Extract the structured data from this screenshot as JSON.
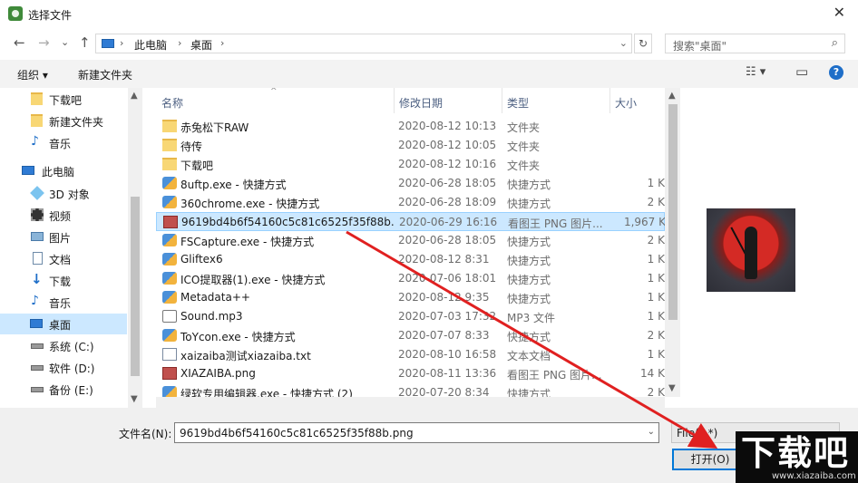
{
  "window": {
    "title": "选择文件",
    "close_glyph": "✕"
  },
  "nav_buttons": {
    "back": "←",
    "forward": "→",
    "recent": "⌄",
    "up": "↑"
  },
  "address": {
    "crumbs": [
      "此电脑",
      "桌面"
    ],
    "separator": "›",
    "dropdown": "⌄",
    "refresh": "↻"
  },
  "search": {
    "placeholder": "搜索\"桌面\"",
    "icon": "⌕"
  },
  "toolbar": {
    "organize": "组织 ▾",
    "new_folder": "新建文件夹",
    "view": "☷ ▾",
    "pane": "▭",
    "help": "?"
  },
  "sidebar": {
    "items": [
      {
        "label": "下载吧",
        "icon": "folder-icon"
      },
      {
        "label": "新建文件夹",
        "icon": "folder-icon"
      },
      {
        "label": "音乐",
        "icon": "music-icon"
      },
      {
        "label": "此电脑",
        "icon": "computer-icon"
      },
      {
        "label": "3D 对象",
        "icon": "cube-icon"
      },
      {
        "label": "视频",
        "icon": "video-icon"
      },
      {
        "label": "图片",
        "icon": "picture-icon"
      },
      {
        "label": "文档",
        "icon": "document-icon"
      },
      {
        "label": "下载",
        "icon": "download-icon"
      },
      {
        "label": "音乐",
        "icon": "music-icon"
      },
      {
        "label": "桌面",
        "icon": "desktop-icon"
      },
      {
        "label": "系统 (C:)",
        "icon": "drive-icon"
      },
      {
        "label": "软件 (D:)",
        "icon": "drive-icon"
      },
      {
        "label": "备份 (E:)",
        "icon": "drive-icon"
      }
    ],
    "selected": "桌面",
    "scroll_up": "▲",
    "scroll_down": "▼"
  },
  "columns": {
    "name": "名称",
    "date": "修改日期",
    "type": "类型",
    "size": "大小",
    "sort_arrow": "^"
  },
  "files": [
    {
      "name": "赤兔松下RAW",
      "date": "2020-08-12 10:13",
      "type": "文件夹",
      "size": "",
      "icon": "folder-icon"
    },
    {
      "name": "待传",
      "date": "2020-08-12 10:05",
      "type": "文件夹",
      "size": "",
      "icon": "folder-icon"
    },
    {
      "name": "下载吧",
      "date": "2020-08-12 10:16",
      "type": "文件夹",
      "size": "",
      "icon": "folder-icon"
    },
    {
      "name": "8uftp.exe - 快捷方式",
      "date": "2020-06-28 18:05",
      "type": "快捷方式",
      "size": "1 K",
      "icon": "shortcut-icon"
    },
    {
      "name": "360chrome.exe - 快捷方式",
      "date": "2020-06-28 18:09",
      "type": "快捷方式",
      "size": "2 K",
      "icon": "shortcut-icon"
    },
    {
      "name": "9619bd4b6f54160c5c81c6525f35f88b...",
      "date": "2020-06-29 16:16",
      "type": "看图王 PNG 图片...",
      "size": "1,967 K",
      "icon": "png-icon"
    },
    {
      "name": "FSCapture.exe - 快捷方式",
      "date": "2020-06-28 18:05",
      "type": "快捷方式",
      "size": "2 K",
      "icon": "shortcut-icon"
    },
    {
      "name": "Gliftex6",
      "date": "2020-08-12 8:31",
      "type": "快捷方式",
      "size": "1 K",
      "icon": "shortcut-icon"
    },
    {
      "name": "ICO提取器(1).exe - 快捷方式",
      "date": "2020-07-06 18:01",
      "type": "快捷方式",
      "size": "1 K",
      "icon": "shortcut-icon"
    },
    {
      "name": "Metadata++",
      "date": "2020-08-12 9:35",
      "type": "快捷方式",
      "size": "1 K",
      "icon": "shortcut-icon"
    },
    {
      "name": "Sound.mp3",
      "date": "2020-07-03 17:32",
      "type": "MP3 文件",
      "size": "1 K",
      "icon": "audio-file-icon"
    },
    {
      "name": "ToYcon.exe - 快捷方式",
      "date": "2020-07-07 8:33",
      "type": "快捷方式",
      "size": "2 K",
      "icon": "shortcut-icon"
    },
    {
      "name": "xaizaiba测试xiazaiba.txt",
      "date": "2020-08-10 16:58",
      "type": "文本文档",
      "size": "1 K",
      "icon": "text-file-icon"
    },
    {
      "name": "XIAZAIBA.png",
      "date": "2020-08-11 13:36",
      "type": "看图王 PNG 图片...",
      "size": "14 K",
      "icon": "png-icon"
    },
    {
      "name": "绿软专用编辑器.exe - 快捷方式 (2)",
      "date": "2020-07-20 8:34",
      "type": "快捷方式",
      "size": "2 K",
      "icon": "shortcut-icon"
    }
  ],
  "selected_file": "9619bd4b6f54160c5c81c6525f35f88b...",
  "filename": {
    "label": "文件名(N):",
    "value": "9619bd4b6f54160c5c81c6525f35f88b.png",
    "dropdown": "⌄"
  },
  "filetype": {
    "value": "File(*.*)",
    "dropdown": "⌄"
  },
  "buttons": {
    "open": "打开(O)"
  },
  "watermark": {
    "text": "下载吧",
    "url": "www.xiazaiba.com"
  },
  "colors": {
    "accent": "#0078d7",
    "selection": "#cce8ff",
    "annotation_arrow": "#e02020",
    "header_text": "#4d6082"
  }
}
